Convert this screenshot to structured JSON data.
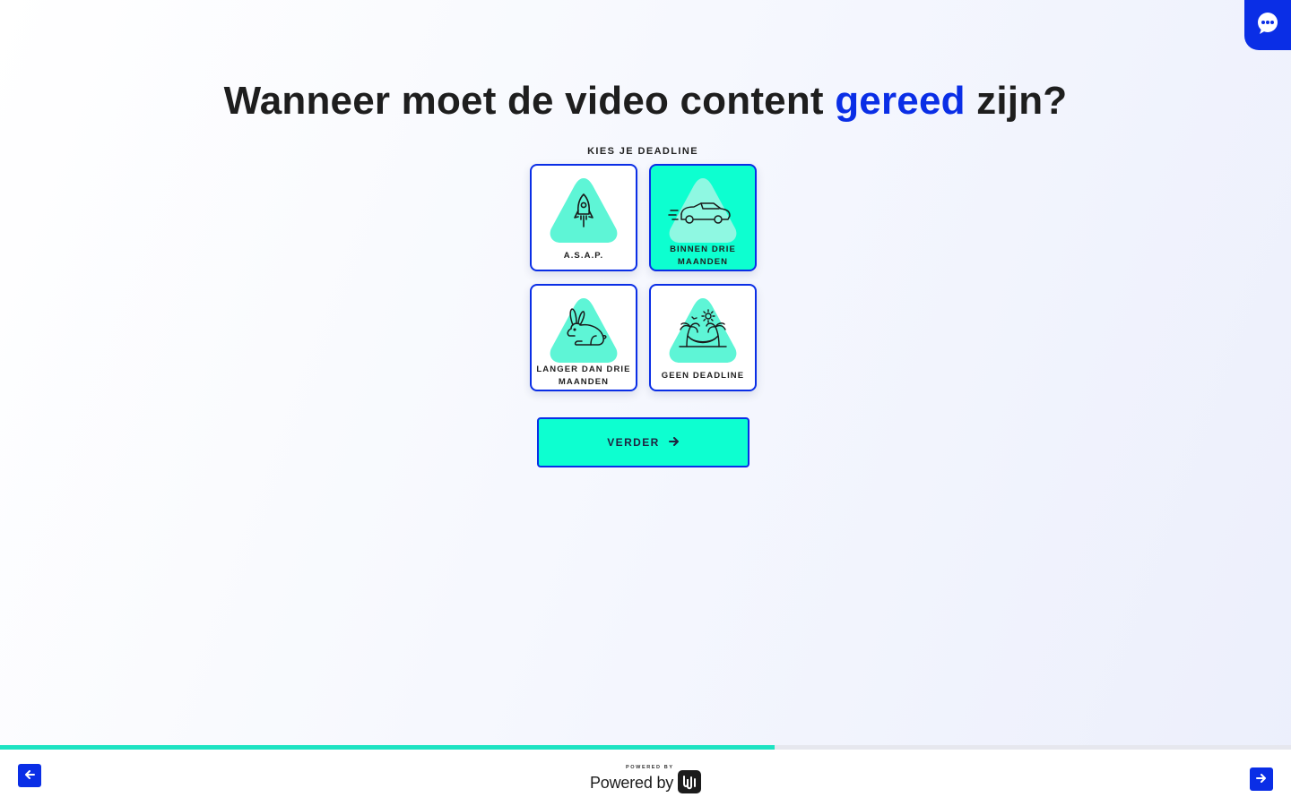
{
  "colors": {
    "accent": "#0a2ee6",
    "mint": "#0dffd0",
    "blob": "#5ef5d6",
    "progress": "#1de3c2"
  },
  "chat": {
    "icon": "chat-bubble-icon"
  },
  "title": {
    "prefix": "Wanneer moet de video content",
    "highlight": "gereed",
    "suffix": "zijn?"
  },
  "subtitle": "KIES JE DEADLINE",
  "options": [
    {
      "label_line1": "A.S.A.P.",
      "label_line2": "",
      "icon": "rocket-icon",
      "selected": false
    },
    {
      "label_line1": "BINNEN DRIE",
      "label_line2": "MAANDEN",
      "icon": "sports-car-icon",
      "selected": true
    },
    {
      "label_line1": "LANGER DAN DRIE",
      "label_line2": "MAANDEN",
      "icon": "rabbit-icon",
      "selected": false
    },
    {
      "label_line1": "GEEN DEADLINE",
      "label_line2": "",
      "icon": "hammock-palms-icon",
      "selected": false
    }
  ],
  "next_button": {
    "label": "VERDER",
    "icon": "arrow-right-icon"
  },
  "progress": {
    "fraction": 0.6
  },
  "footer": {
    "prev_icon": "arrow-left-icon",
    "next_icon": "arrow-right-icon",
    "powered_small": "POWERED BY",
    "powered_text": "Powered by"
  }
}
